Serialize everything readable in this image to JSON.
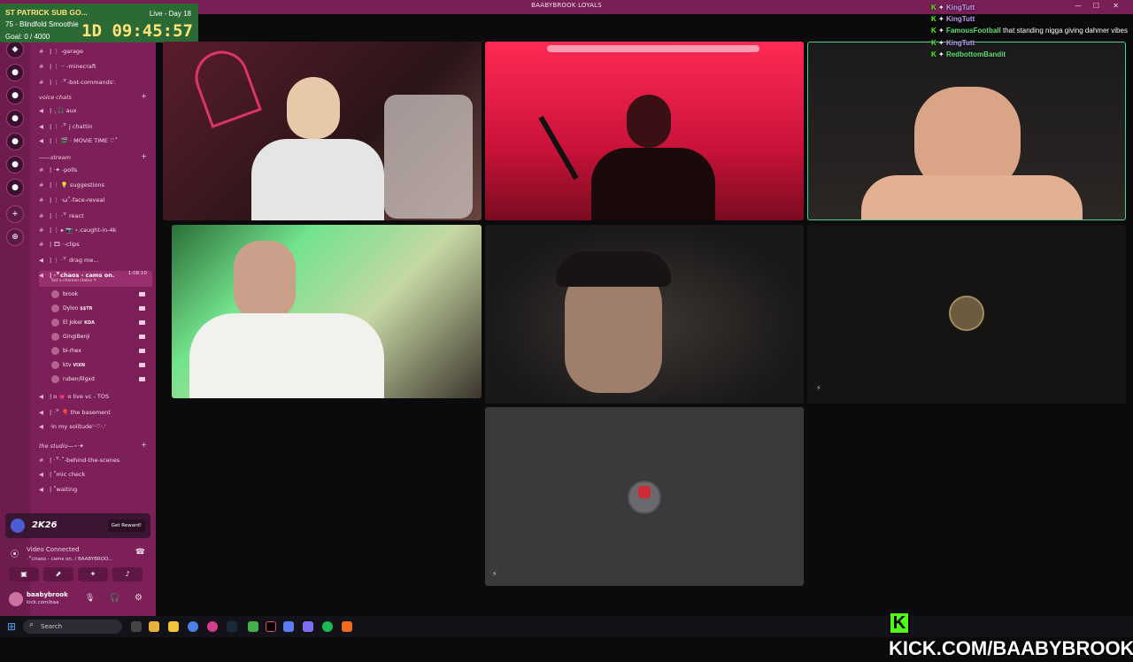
{
  "window": {
    "title": "BAABYBROOK LOYALS"
  },
  "timer": {
    "line1": "ST PATRICK SUB GO...",
    "line2": "75 - Blindfold Smoothie",
    "line3": "Goal: 0 / 4000",
    "live": "Live - Day 18",
    "countdown": "1D 09:45:57"
  },
  "channels": {
    "items": [
      {
        "label": "| ⋮ -garage",
        "type": "text"
      },
      {
        "label": "| ⋮ ·· -minecraft",
        "type": "text"
      },
      {
        "label": "| ⋮ ·꒷-bot-commands'.",
        "type": "text"
      },
      {
        "cat": "voice chats"
      },
      {
        "label": "| ·̩͙ 🎧 aux",
        "type": "voice"
      },
      {
        "label": "| ⋮ ·꒷ j chattin",
        "type": "voice"
      },
      {
        "label": "| ⋮ 🎬 · MOVIE TIME ♡˚",
        "type": "voice"
      },
      {
        "cat": "——stream"
      },
      {
        "label": "| ·✦ -polls",
        "type": "text"
      },
      {
        "label": "| ⋮ 💡 suggestions",
        "type": "text"
      },
      {
        "label": "| ⋮ ·ω˚-face-reveal",
        "type": "text"
      },
      {
        "label": "| ⋮ ·꒷ react",
        "type": "text"
      },
      {
        "label": "| ⋮ ▸ 📷 ⋆.caught-in-4k",
        "type": "text"
      },
      {
        "label": "| 🎞 ·-clips",
        "type": "text"
      },
      {
        "label": "| ⋮ ·꒷ drag me...",
        "type": "voice"
      }
    ],
    "active": {
      "label": "| ·꒷chaos - cams on.",
      "time": "1:08:10",
      "status": "Set a channel status ✎"
    },
    "users": [
      {
        "name": "brook",
        "tag": ""
      },
      {
        "name": "Dylon",
        "tag": "$$TR"
      },
      {
        "name": "El Joker",
        "tag": "KDA"
      },
      {
        "name": "GingiBenji",
        "tag": ""
      },
      {
        "name": "bi-rhex",
        "tag": ""
      },
      {
        "name": "ktv",
        "tag": "VIXN"
      },
      {
        "name": "ruben/lilgxd",
        "tag": ""
      }
    ],
    "after": [
      {
        "label": "| o 💗 o live vc - TOS",
        "type": "voice"
      },
      {
        "label": "| ·꒷ 🎈 the basement",
        "type": "voice"
      },
      {
        "label": "·in my solitude'·♡·.'",
        "type": "voice"
      }
    ],
    "studio_cat": "the studio—⋆·✦",
    "studio": [
      {
        "label": "| ·꒷·˚-behind-the-scenes",
        "type": "text"
      },
      {
        "label": "| ˚mic check",
        "type": "voice"
      },
      {
        "label": "| ˚waiting",
        "type": "voice"
      }
    ]
  },
  "promo": {
    "game": "2K26",
    "button": "Get Reward!"
  },
  "voice_connected": {
    "label": "Video Connected",
    "channel": "·꒷chaos - cams on. / BAABYBROO..."
  },
  "user": {
    "name": "baabybrook",
    "status": "kick.com/baa"
  },
  "chat": [
    {
      "user": "KingTutt",
      "text": "",
      "style": "u"
    },
    {
      "user": "KingTutt",
      "text": "",
      "style": "u"
    },
    {
      "user": "FamousFootball",
      "text": "that standing nigga giving dahmer vibes",
      "style": "u2"
    },
    {
      "user": "KingTutt",
      "text": "",
      "style": "u"
    },
    {
      "user": "RedbottomBandit",
      "text": "",
      "style": "u2"
    }
  ],
  "taskbar": {
    "search": "Search"
  },
  "overlay": {
    "kick": "KICK.COM/BAABYBROOK",
    "k": "K"
  },
  "colors": {
    "accent": "#7d2059",
    "kick_green": "#53fc18"
  }
}
